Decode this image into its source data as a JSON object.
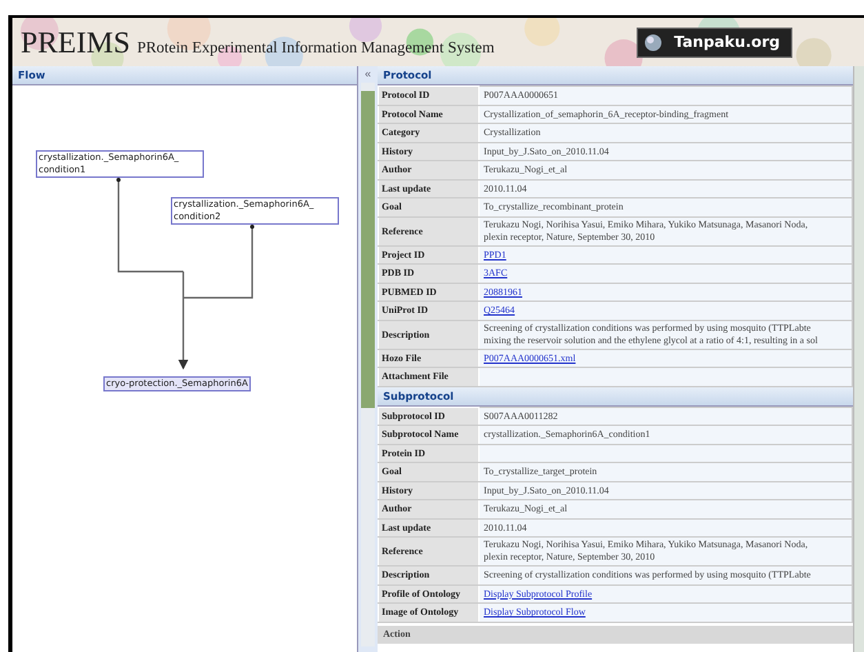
{
  "header": {
    "title": "PREIMS",
    "subtitle": "PRotein Experimental Information Management System",
    "logo": "Tanpaku.org"
  },
  "flow": {
    "title": "Flow",
    "collapse": "«",
    "nodes": [
      {
        "lines": [
          "crystallization._Semaphorin6A_",
          "condition1"
        ]
      },
      {
        "lines": [
          "crystallization._Semaphorin6A_",
          "condition2"
        ]
      },
      {
        "lines": [
          "cryo-protection._Semaphorin6A"
        ]
      }
    ]
  },
  "protocol": {
    "title": "Protocol",
    "rows": [
      {
        "label": "Protocol ID",
        "value": "P007AAA0000651",
        "kind": "text"
      },
      {
        "label": "Protocol Name",
        "value": "Crystallization_of_semaphorin_6A_receptor-binding_fragment",
        "kind": "text"
      },
      {
        "label": "Category",
        "value": "Crystallization",
        "kind": "text"
      },
      {
        "label": "History",
        "value": "Input_by_J.Sato_on_2010.11.04",
        "kind": "text"
      },
      {
        "label": "Author",
        "value": "Terukazu_Nogi_et_al",
        "kind": "text"
      },
      {
        "label": "Last update",
        "value": "2010.11.04",
        "kind": "text"
      },
      {
        "label": "Goal",
        "value": "To_crystallize_recombinant_protein",
        "kind": "text"
      },
      {
        "label": "Reference",
        "lines": [
          "Terukazu Nogi, Norihisa Yasui, Emiko Mihara, Yukiko Matsunaga, Masanori Noda,",
          "plexin receptor, Nature, September 30, 2010"
        ],
        "kind": "text"
      },
      {
        "label": "Project ID",
        "value": "PPD1",
        "kind": "link"
      },
      {
        "label": "PDB ID",
        "value": "3AFC",
        "kind": "link"
      },
      {
        "label": "PUBMED ID",
        "value": "20881961",
        "kind": "link"
      },
      {
        "label": "UniProt ID",
        "value": "Q25464",
        "kind": "link"
      },
      {
        "label": "Description",
        "lines": [
          "Screening of crystallization conditions was performed by using mosquito (TTPLabte",
          "mixing the reservoir solution and the ethylene glycol at a ratio of 4:1, resulting in a sol"
        ],
        "kind": "text"
      },
      {
        "label": "Hozo File",
        "value": "P007AAA0000651.xml",
        "kind": "link"
      },
      {
        "label": "Attachment File",
        "kind": "text"
      }
    ]
  },
  "subprotocol": {
    "title": "Subprotocol",
    "rows": [
      {
        "label": "Subprotocol ID",
        "value": "S007AAA0011282",
        "kind": "text"
      },
      {
        "label": "Subprotocol Name",
        "value": "crystallization._Semaphorin6A_condition1",
        "kind": "text"
      },
      {
        "label": "Protein ID",
        "kind": "text"
      },
      {
        "label": "Goal",
        "value": "To_crystallize_target_protein",
        "kind": "text"
      },
      {
        "label": "History",
        "value": "Input_by_J.Sato_on_2010.11.04",
        "kind": "text"
      },
      {
        "label": "Author",
        "value": "Terukazu_Nogi_et_al",
        "kind": "text"
      },
      {
        "label": "Last update",
        "value": "2010.11.04",
        "kind": "text"
      },
      {
        "label": "Reference",
        "lines": [
          "Terukazu Nogi, Norihisa Yasui, Emiko Mihara, Yukiko Matsunaga, Masanori Noda,",
          "plexin receptor, Nature, September 30, 2010"
        ],
        "kind": "text"
      },
      {
        "label": "Description",
        "value": "Screening of crystallization conditions was performed by using mosquito (TTPLabte",
        "kind": "text"
      },
      {
        "label": "Profile of Ontology",
        "value": "Display Subprotocol Profile",
        "kind": "link"
      },
      {
        "label": "Image of Ontology",
        "value": "Display Subprotocol Flow",
        "kind": "link"
      }
    ]
  },
  "action": {
    "title": "Action"
  }
}
